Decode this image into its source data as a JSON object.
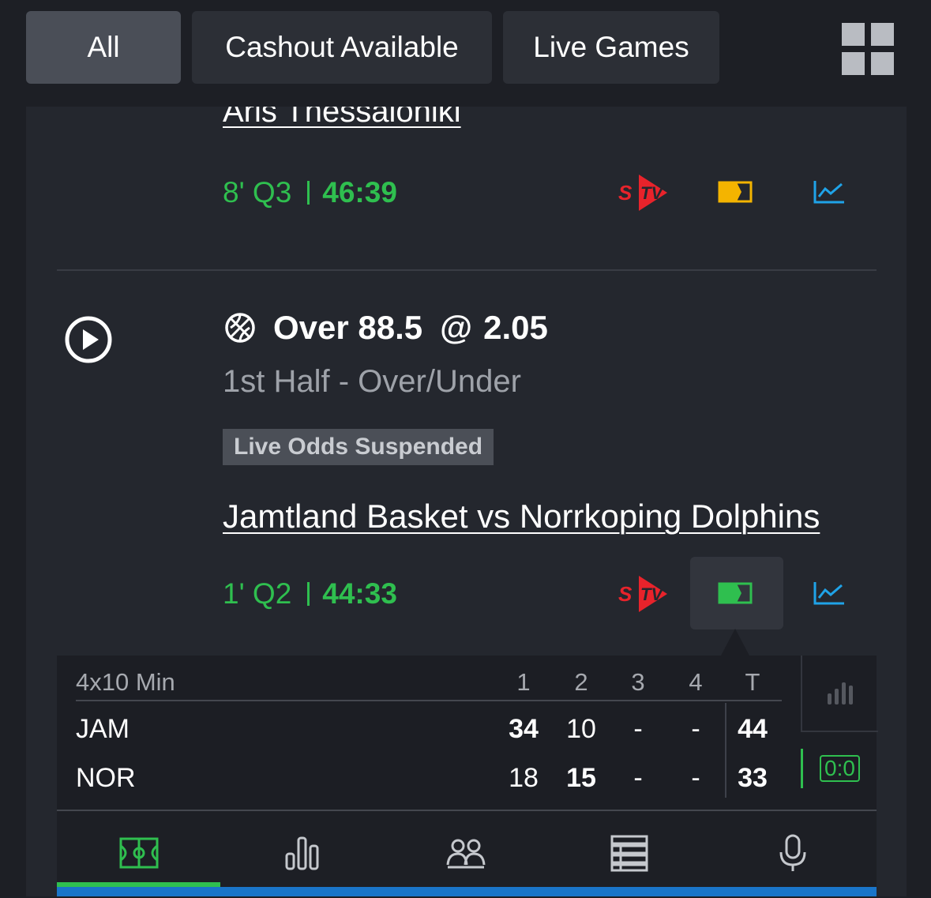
{
  "filters": {
    "all": "All",
    "cashout": "Cashout Available",
    "live": "Live Games"
  },
  "bet1": {
    "match": "Aris Thessaloniki",
    "period": "8' Q3",
    "clock": "46:39"
  },
  "bet2": {
    "selection": "Over 88.5",
    "at": "@",
    "odds": "2.05",
    "market": "1st Half - Over/Under",
    "status": "Live Odds Suspended",
    "match": "Jamtland Basket vs Norrkoping Dolphins",
    "period": "1' Q2",
    "clock": "44:33"
  },
  "scoreboard": {
    "format": "4x10 Min",
    "headers": [
      "1",
      "2",
      "3",
      "4",
      "T"
    ],
    "home": {
      "team": "JAM",
      "q": [
        "34",
        "10",
        "-",
        "-"
      ],
      "total": "44"
    },
    "away": {
      "team": "NOR",
      "q": [
        "18",
        "15",
        "-",
        "-"
      ],
      "total": "33"
    },
    "score_button": "0:0"
  },
  "icons": {
    "tv": "stv-stream-icon",
    "tracker": "match-tracker-icon",
    "stats": "stats-chart-icon",
    "nav": [
      "court-icon",
      "bar-stats-icon",
      "lineups-icon",
      "table-icon",
      "microphone-icon"
    ]
  },
  "colors": {
    "live_green": "#2fbf4f",
    "stv_red": "#e8232b",
    "tracker_yellow": "#f4b400",
    "chart_blue": "#1fa3e8"
  }
}
